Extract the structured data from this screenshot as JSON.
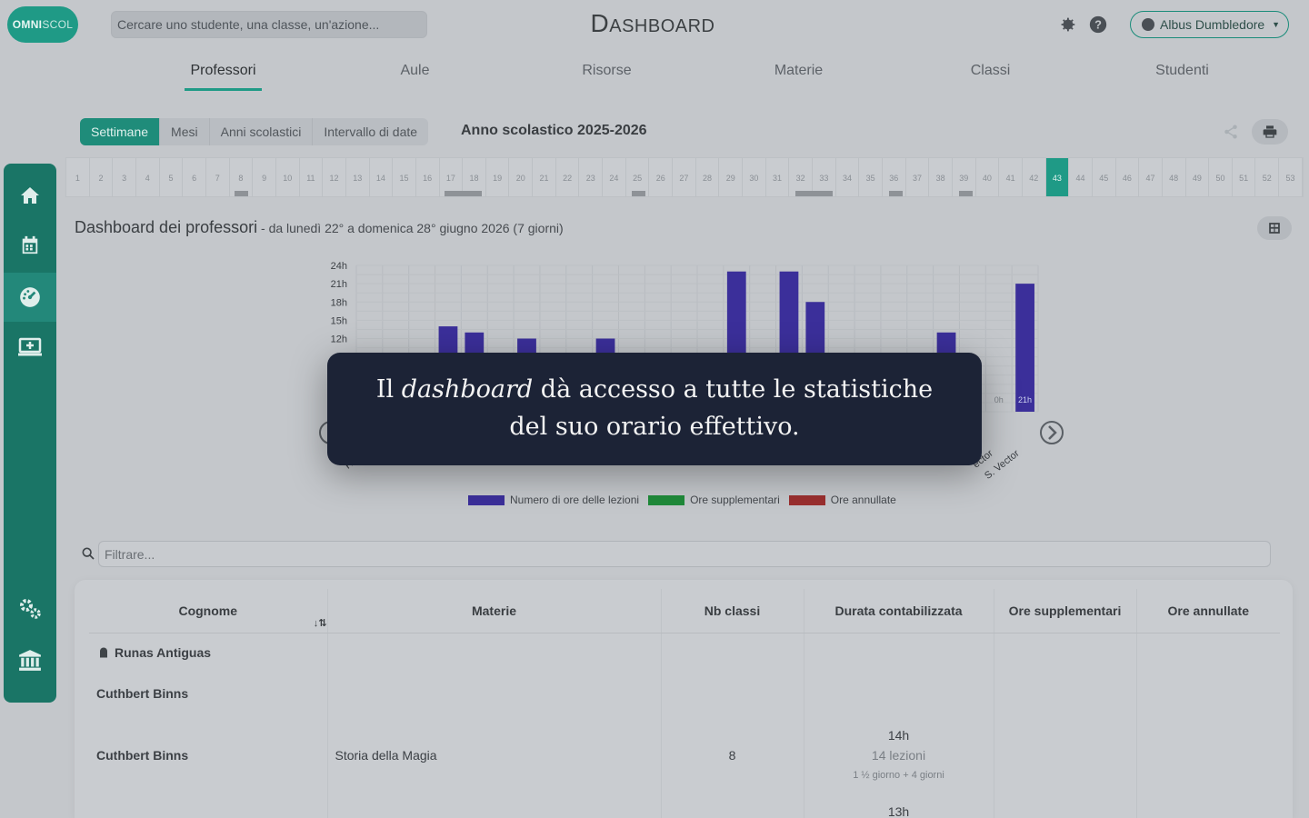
{
  "header": {
    "logo": {
      "part1": "OMNI",
      "part2": "SCOL"
    },
    "search_placeholder": "Cercare uno studente, una classe, un'azione...",
    "title": "Dashboard",
    "icons": [
      "settings-cog-icon",
      "help-icon"
    ],
    "user": "Albus Dumbledore"
  },
  "tabs": [
    {
      "label": "Professori",
      "active": true
    },
    {
      "label": "Aule"
    },
    {
      "label": "Risorse"
    },
    {
      "label": "Materie"
    },
    {
      "label": "Classi"
    },
    {
      "label": "Studenti"
    }
  ],
  "period": {
    "options": [
      "Settimane",
      "Mesi",
      "Anni scolastici",
      "Intervallo di date"
    ],
    "selected": "Settimane",
    "year": "Anno scolastico 2025-2026"
  },
  "weeks": {
    "labels": [
      "1",
      "2",
      "3",
      "4",
      "5",
      "6",
      "7",
      "8",
      "9",
      "10",
      "11",
      "12",
      "13",
      "14",
      "15",
      "16",
      "17",
      "18",
      "19",
      "20",
      "21",
      "22",
      "23",
      "24",
      "25",
      "26",
      "27",
      "28",
      "29",
      "30",
      "31",
      "32",
      "33",
      "34",
      "35",
      "36",
      "37",
      "38",
      "39",
      "40",
      "41",
      "42",
      "43",
      "44",
      "45",
      "46",
      "47",
      "48",
      "49",
      "50",
      "51",
      "52",
      "53"
    ],
    "current": "43",
    "marked": [
      {
        "from": 8,
        "to": 8
      },
      {
        "from": 17,
        "to": 18
      },
      {
        "from": 25,
        "to": 25
      },
      {
        "from": 32,
        "to": 33
      },
      {
        "from": 36,
        "to": 36
      },
      {
        "from": 39,
        "to": 39
      }
    ]
  },
  "sidebar": {
    "items": [
      {
        "icon": "home-icon"
      },
      {
        "icon": "calendar-icon"
      },
      {
        "icon": "dashboard-gauge-icon",
        "active": true
      },
      {
        "icon": "monitor-plus-icon"
      },
      {
        "icon": "cogs-icon"
      },
      {
        "icon": "institution-icon"
      }
    ]
  },
  "dashboard": {
    "title": "Dashboard dei professori",
    "range": " - da lunedì 22° a domenica 28° giugno 2026 (7 giorni)"
  },
  "chart_data": {
    "type": "bar",
    "y_ticks": [
      "24h",
      "21h",
      "18h",
      "15h",
      "12h"
    ],
    "ylim": [
      0,
      24
    ],
    "series": [
      {
        "name": "Numero di ore delle lezioni",
        "color": "#3b2f9a",
        "values": [
          null,
          null,
          null,
          14,
          13,
          null,
          12,
          null,
          null,
          12,
          null,
          null,
          null,
          null,
          23,
          null,
          23,
          18,
          null,
          null,
          null,
          null,
          13,
          null,
          null,
          21
        ]
      },
      {
        "name": "Ore supplementari",
        "color": "#1f8a3a"
      },
      {
        "name": "Ore annullate",
        "color": "#9a2f2f"
      }
    ],
    "data_labels": [
      "0h",
      "21h"
    ],
    "x_labels_visible": [
      "Runa",
      "S.",
      "M.",
      "M.",
      "ector",
      "S. Vector"
    ]
  },
  "overlay": {
    "before": "Il ",
    "emphasis": "dashboard",
    "after": " dà accesso a tutte le statistiche del suo orario effettivo."
  },
  "filter": {
    "placeholder": "Filtrare..."
  },
  "table": {
    "columns": [
      "Cognome",
      "Materie",
      "Nb classi",
      "Durata contabilizzata",
      "Ore supplementari",
      "Ore annullate"
    ],
    "group": "Runas Antiguas",
    "rows": [
      {
        "name": "Cuthbert Binns"
      },
      {
        "name": "Cuthbert Binns",
        "subject": "Storia della Magia",
        "classes": "8",
        "duration": "14h",
        "lessons": "14 lezioni",
        "days": "1 ½ giorno + 4 giorni"
      },
      {
        "duration": "13h"
      }
    ]
  }
}
